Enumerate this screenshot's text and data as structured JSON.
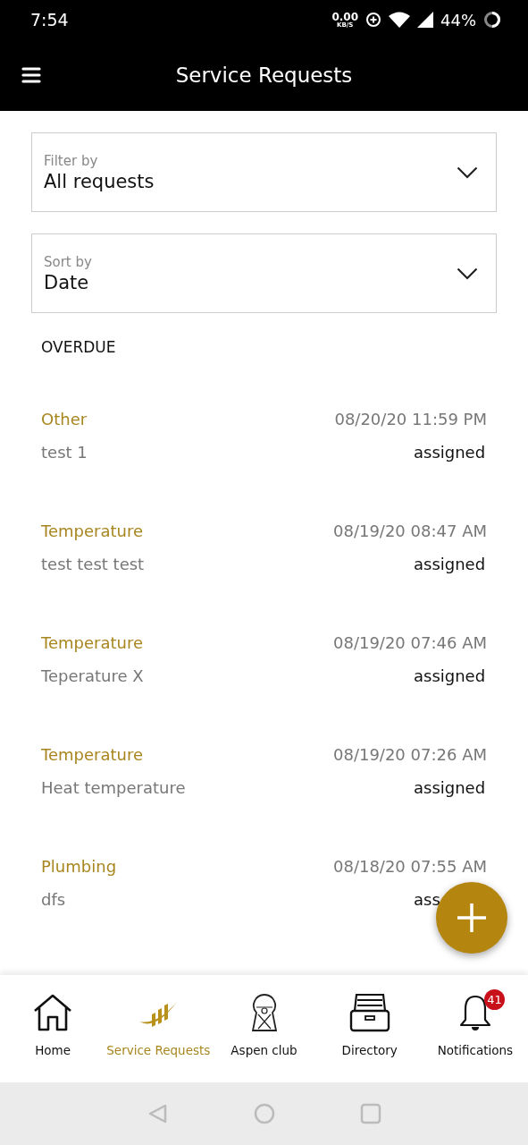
{
  "status_bar": {
    "time": "7:54",
    "speed_value": "0.00",
    "speed_unit": "KB/S",
    "battery": "44%"
  },
  "app_bar": {
    "title": "Service Requests"
  },
  "filters": [
    {
      "label": "Filter by",
      "value": "All requests"
    },
    {
      "label": "Sort by",
      "value": "Date"
    }
  ],
  "section_title": "OVERDUE",
  "requests": [
    {
      "category": "Other",
      "date": "08/20/20 11:59 PM",
      "description": "test 1",
      "status": "assigned"
    },
    {
      "category": "Temperature",
      "date": "08/19/20 08:47 AM",
      "description": "test test test",
      "status": "assigned"
    },
    {
      "category": "Temperature",
      "date": "08/19/20 07:46 AM",
      "description": "Teperature X",
      "status": "assigned"
    },
    {
      "category": "Temperature",
      "date": "08/19/20 07:26 AM",
      "description": "Heat temperature",
      "status": "assigned"
    },
    {
      "category": "Plumbing",
      "date": "08/18/20 07:55 AM",
      "description": "dfs",
      "status": "ass"
    }
  ],
  "bottom_nav": [
    {
      "kind": "home",
      "label": "Home",
      "selected": false
    },
    {
      "kind": "service",
      "label": "Service Requests",
      "selected": true
    },
    {
      "kind": "club",
      "label": "Aspen club",
      "selected": false
    },
    {
      "kind": "directory",
      "label": "Directory",
      "selected": false
    },
    {
      "kind": "notifications",
      "label": "Notifications",
      "selected": false,
      "badge": "41"
    }
  ]
}
